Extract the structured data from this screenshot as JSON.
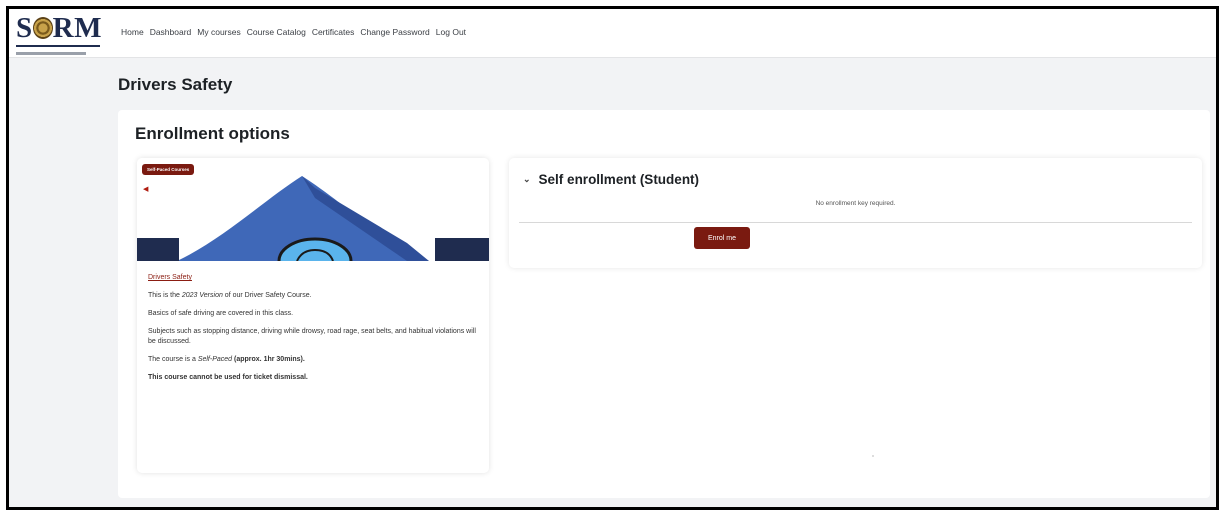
{
  "brand": {
    "logo_text_pre": "S",
    "logo_text_post": "RM"
  },
  "nav": {
    "links": [
      "Home",
      "Dashboard",
      "My courses",
      "Course Catalog",
      "Certificates",
      "Change Password",
      "Log Out"
    ]
  },
  "page": {
    "title": "Drivers Safety"
  },
  "section": {
    "title": "Enrollment options"
  },
  "course": {
    "badge": "Self-Paced Courses",
    "name": "Drivers Safety",
    "desc_prefix": "This is the ",
    "desc_year": "2023 Version",
    "desc_suffix": " of our Driver Safety Course.",
    "basics": "Basics of safe driving are covered in this class.",
    "subjects": "Subjects such as stopping distance, driving while drowsy, road rage, seat belts, and habitual violations will be discussed.",
    "pace_prefix": "The course is a ",
    "pace_italic": "Self-Paced",
    "pace_bold": " (approx. 1hr 30mins).",
    "warning": "This course cannot be used for ticket dismissal."
  },
  "enrollment": {
    "heading": "Self enrollment (Student)",
    "note": "No enrollment key required.",
    "button": "Enrol me"
  },
  "colors": {
    "accent": "#7a1a10",
    "brand_navy": "#1f2c4f",
    "tent_blue": "#3f68b8",
    "page_bg": "#f2f3f5"
  },
  "icons": {
    "chevron": "chevron-down-icon",
    "speaker": "speaker-icon"
  }
}
